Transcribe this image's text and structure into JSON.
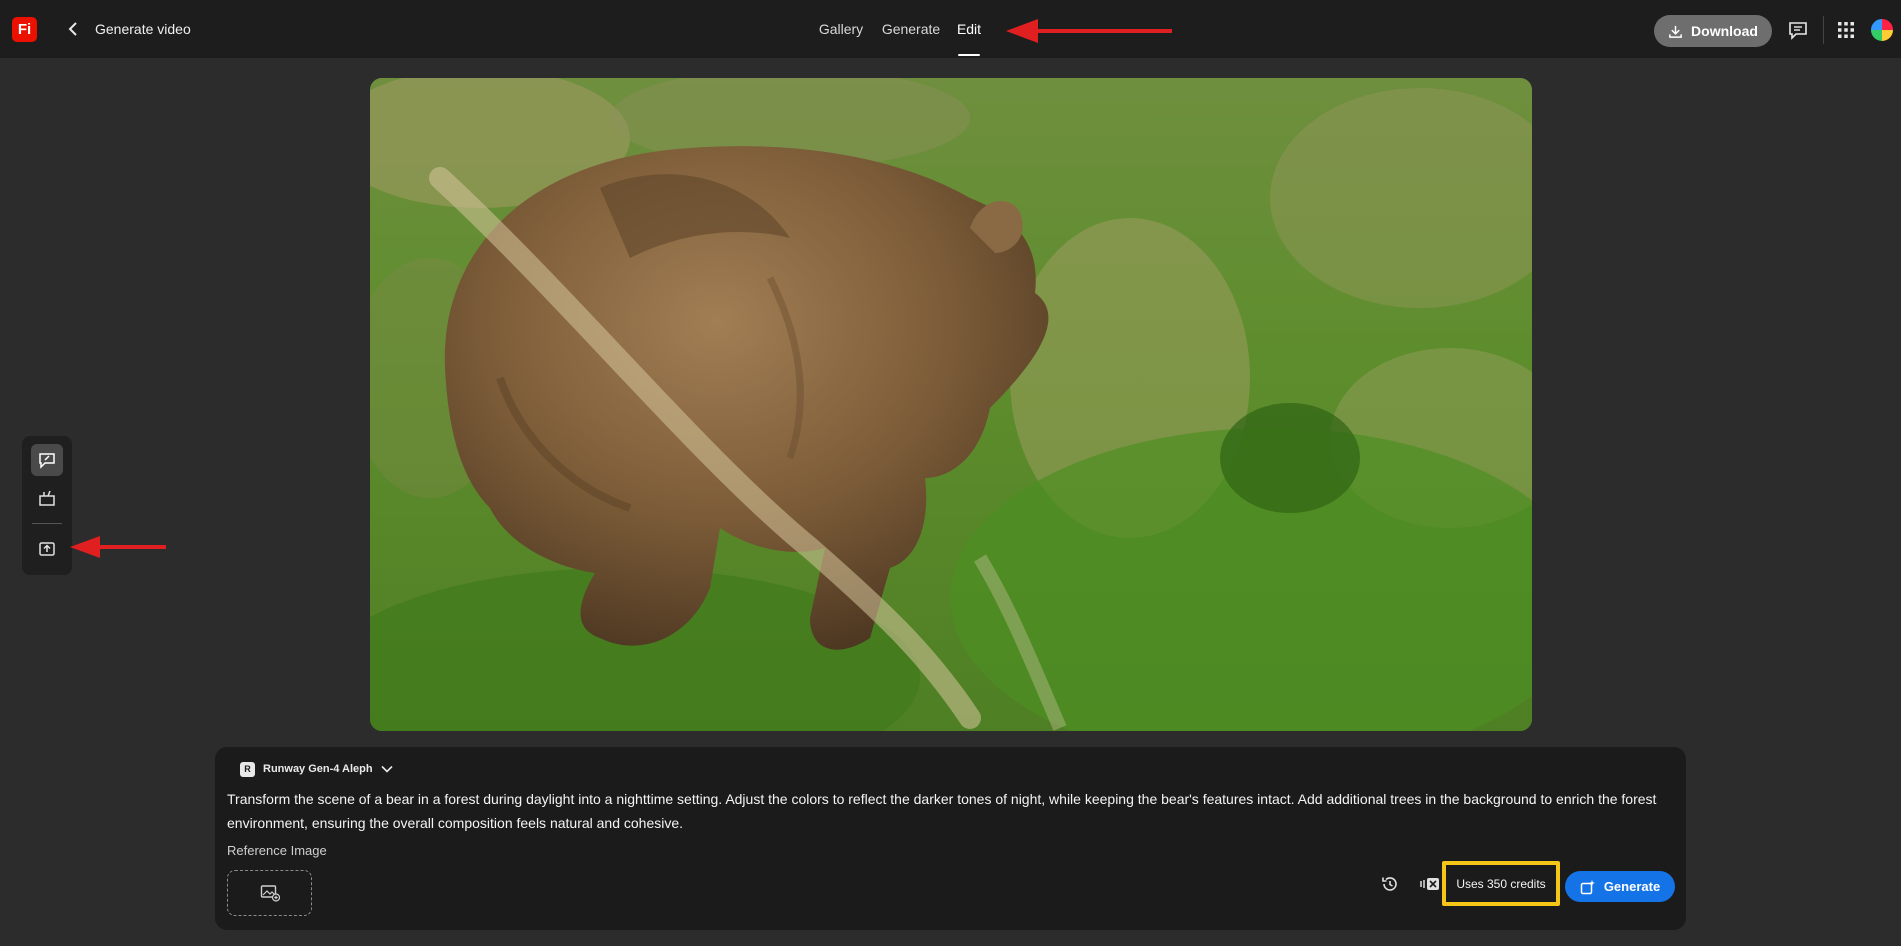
{
  "app": {
    "logo_text": "Fi",
    "title": "Generate video"
  },
  "nav": {
    "tabs": [
      {
        "label": "Gallery"
      },
      {
        "label": "Generate"
      },
      {
        "label": "Edit",
        "active": true
      }
    ]
  },
  "header": {
    "download_label": "Download"
  },
  "toolbar_icons": [
    "chat-edit-icon",
    "scene-edit-icon",
    "upload-frame-icon"
  ],
  "preview": {
    "subject": "brown-bear-on-grassy-hillside"
  },
  "prompt_panel": {
    "model": {
      "icon_text": "R",
      "label": "Runway Gen-4 Aleph"
    },
    "prompt_text": "Transform the scene of a bear in a forest during daylight into a nighttime setting. Adjust the colors to reflect the darker tones of night, while keeping the bear's features intact. Add additional trees in the background to enrich the forest environment, ensuring the overall composition feels natural and cohesive.",
    "reference_label": "Reference Image",
    "credits_label": "Uses 350 credits",
    "generate_label": "Generate"
  },
  "colors": {
    "accent": "#1473e6",
    "highlight_box": "#f5c518",
    "annotation_arrow": "#e02020",
    "logo_bg": "#eb1000"
  }
}
